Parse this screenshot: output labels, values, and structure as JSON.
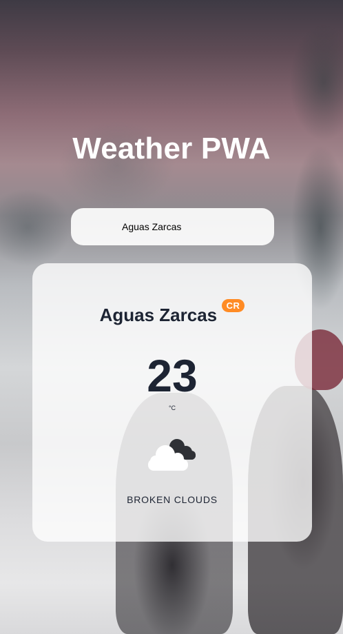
{
  "app": {
    "title": "Weather PWA"
  },
  "search": {
    "value": "Aguas Zarcas"
  },
  "weather_card": {
    "city": "Aguas Zarcas",
    "country_code": "CR",
    "temperature": "23",
    "unit": "°C",
    "icon": "broken-clouds-icon",
    "description": "BROKEN CLOUDS"
  },
  "colors": {
    "title_text": "#ffffff",
    "card_text": "#1d2433",
    "badge_bg": "#ff8b24",
    "badge_text": "#ffffff",
    "card_bg": "rgba(255,255,255,0.78)"
  }
}
